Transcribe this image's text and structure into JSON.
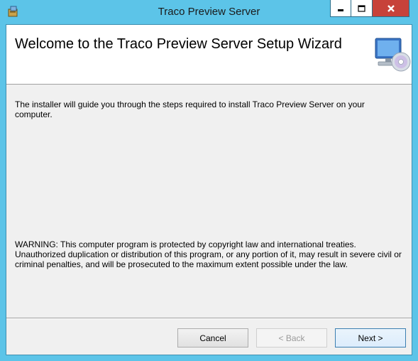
{
  "window": {
    "title": "Traco Preview Server",
    "icon": "installer-icon",
    "controls": {
      "minimize": "minimize-icon",
      "maximize": "maximize-icon",
      "close": "close-icon"
    }
  },
  "banner": {
    "title": "Welcome to the Traco Preview Server Setup Wizard",
    "icon": "computer-disc-icon"
  },
  "body": {
    "intro": "The installer will guide you through the steps required to install Traco Preview Server on your computer.",
    "warning": "WARNING: This computer program is protected by copyright law and international treaties. Unauthorized duplication or distribution of this program, or any portion of it, may result in severe civil or criminal penalties, and will be prosecuted to the maximum extent possible under the law."
  },
  "buttons": {
    "cancel": "Cancel",
    "back": "< Back",
    "next": "Next >"
  },
  "colors": {
    "frame": "#5cc4e8",
    "close": "#c7423a",
    "dialog_bg": "#f0f0f0"
  }
}
